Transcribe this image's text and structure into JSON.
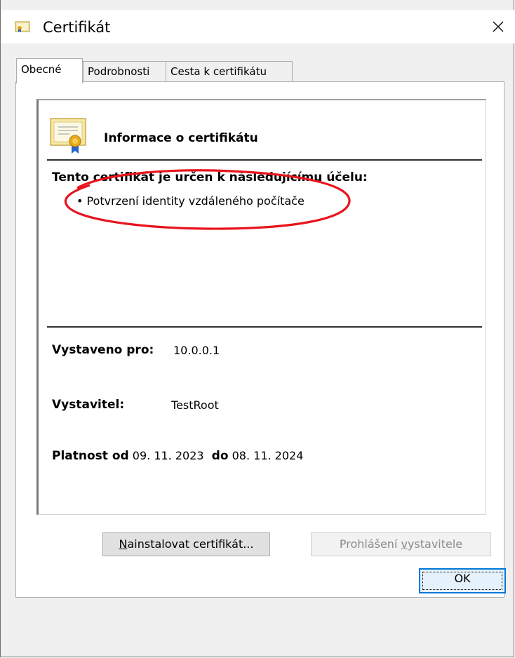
{
  "window": {
    "title": "Certifikát",
    "close_glyph": "✕"
  },
  "tabs": [
    {
      "label": "Obecné",
      "active": true
    },
    {
      "label": "Podrobnosti",
      "active": false
    },
    {
      "label": "Cesta k certifikátu",
      "active": false
    }
  ],
  "certificate": {
    "heading": "Informace o certifikátu",
    "purpose_title": "Tento certifikát je určen k následujícímu účelu:",
    "purpose_item": "• Potvrzení identity vzdáleného počítače",
    "issued_to_label": "Vystaveno pro:",
    "issued_to_value": "10.0.0.1",
    "issuer_label": "Vystavitel:",
    "issuer_value": "TestRoot",
    "validity_label": "Platnost od",
    "valid_from": "09. 11. 2023",
    "validity_to_label": "do",
    "valid_to": "08. 11. 2024"
  },
  "buttons": {
    "install": "Nainstalovat certifikát...",
    "install_mnemonic": "N",
    "install_rest": "ainstalovat certifikát...",
    "issuer_statement_pre": "Prohlášení ",
    "issuer_statement_mnemonic": "v",
    "issuer_statement_post": "ystavitele",
    "ok": "OK"
  },
  "annotation": {
    "color": "#e8141c",
    "shape": "ellipse around purpose item"
  },
  "icons": {
    "title_icon": "certificate-icon",
    "cert_icon": "certificate-ribbon-icon",
    "close_icon": "close-icon"
  }
}
